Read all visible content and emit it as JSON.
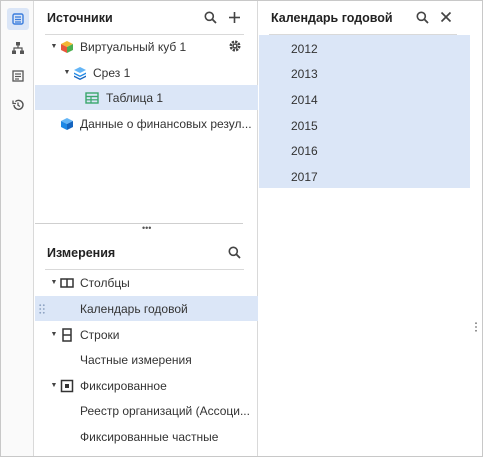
{
  "rail": {
    "items": [
      {
        "icon": "data-sources-icon",
        "active": true
      },
      {
        "icon": "hierarchy-icon",
        "active": false
      },
      {
        "icon": "report-text-icon",
        "active": false
      },
      {
        "icon": "history-icon",
        "active": false
      }
    ]
  },
  "sources": {
    "title": "Источники",
    "tree": [
      {
        "label": "Виртуальный куб 1",
        "icon": "cube-multicolor-icon",
        "expanded": true
      },
      {
        "label": "Срез 1",
        "icon": "layers-icon",
        "expanded": true
      },
      {
        "label": "Таблица 1",
        "icon": "table-icon",
        "selected": true
      },
      {
        "label": "Данные о финансовых резул...",
        "icon": "cube-blue-icon"
      }
    ]
  },
  "dimensions": {
    "title": "Измерения",
    "items": [
      {
        "label": "Столбцы",
        "icon": "columns-icon",
        "group": true
      },
      {
        "label": "Календарь годовой",
        "selected": true
      },
      {
        "label": "Строки",
        "icon": "rows-icon",
        "group": true
      },
      {
        "label": "Частные измерения"
      },
      {
        "label": "Фиксированное",
        "icon": "fixed-icon",
        "group": true
      },
      {
        "label": "Реестр организаций (Ассоци..."
      },
      {
        "label": "Фиксированные частные"
      }
    ]
  },
  "calendar": {
    "title": "Календарь годовой",
    "years": [
      "2012",
      "2013",
      "2014",
      "2015",
      "2016",
      "2017"
    ]
  },
  "colors": {
    "selection": "#dbe6f7",
    "accent": "#3b7ddd"
  }
}
